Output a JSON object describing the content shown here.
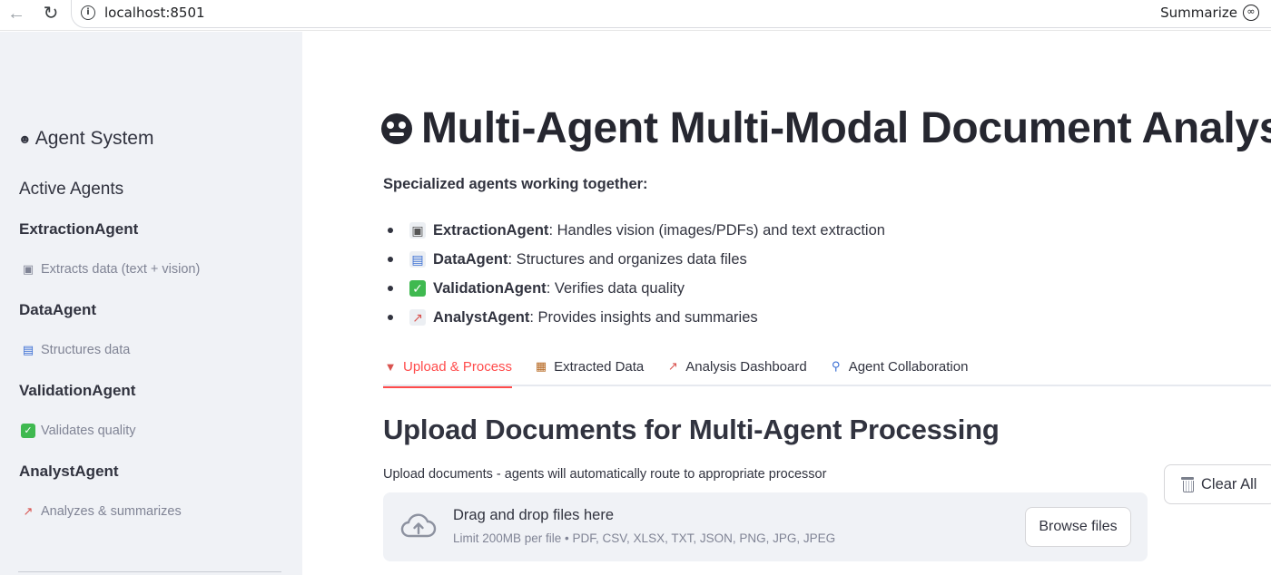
{
  "browser": {
    "url": "localhost:8501",
    "summarize_label": "Summarize",
    "back_icon": "back-arrow-icon",
    "reload_icon": "reload-icon"
  },
  "sidebar": {
    "title": "Agent System",
    "section_heading": "Active Agents",
    "agents": [
      {
        "name": "ExtractionAgent",
        "desc": "Extracts data (text + vision)",
        "icon": "camera-icon"
      },
      {
        "name": "DataAgent",
        "desc": "Structures data",
        "icon": "bar-chart-icon"
      },
      {
        "name": "ValidationAgent",
        "desc": "Validates quality",
        "icon": "check-icon"
      },
      {
        "name": "AnalystAgent",
        "desc": "Analyzes & summarizes",
        "icon": "trend-chart-icon"
      }
    ]
  },
  "main": {
    "title": "Multi-Agent Multi-Modal Document Analysis",
    "intro": "Specialized agents working together:",
    "bullets": [
      {
        "agent": "ExtractionAgent",
        "text": ": Handles vision (images/PDFs) and text extraction",
        "icon": "camera-icon"
      },
      {
        "agent": "DataAgent",
        "text": ": Structures and organizes data files",
        "icon": "bar-chart-icon"
      },
      {
        "agent": "ValidationAgent",
        "text": ": Verifies data quality",
        "icon": "check-icon"
      },
      {
        "agent": "AnalystAgent",
        "text": ": Provides insights and summaries",
        "icon": "trend-chart-icon"
      }
    ],
    "tabs": [
      {
        "label": "Upload & Process",
        "icon": "inbox-tray-icon",
        "active": true
      },
      {
        "label": "Extracted Data",
        "icon": "clipboard-icon",
        "active": false
      },
      {
        "label": "Analysis Dashboard",
        "icon": "trend-chart-icon",
        "active": false
      },
      {
        "label": "Agent Collaboration",
        "icon": "magnifier-icon",
        "active": false
      }
    ],
    "section_title": "Upload Documents for Multi-Agent Processing",
    "upload_label": "Upload documents - agents will automatically route to appropriate processor",
    "dropzone": {
      "main_text": "Drag and drop files here",
      "sub_text": "Limit 200MB per file • PDF, CSV, XLSX, TXT, JSON, PNG, JPG, JPEG",
      "browse_label": "Browse files"
    },
    "clear_label": "Clear All"
  },
  "colors": {
    "accent": "#ff4b4b",
    "sidebar_bg": "#f0f2f6",
    "text": "#31333f",
    "muted": "#808495"
  }
}
